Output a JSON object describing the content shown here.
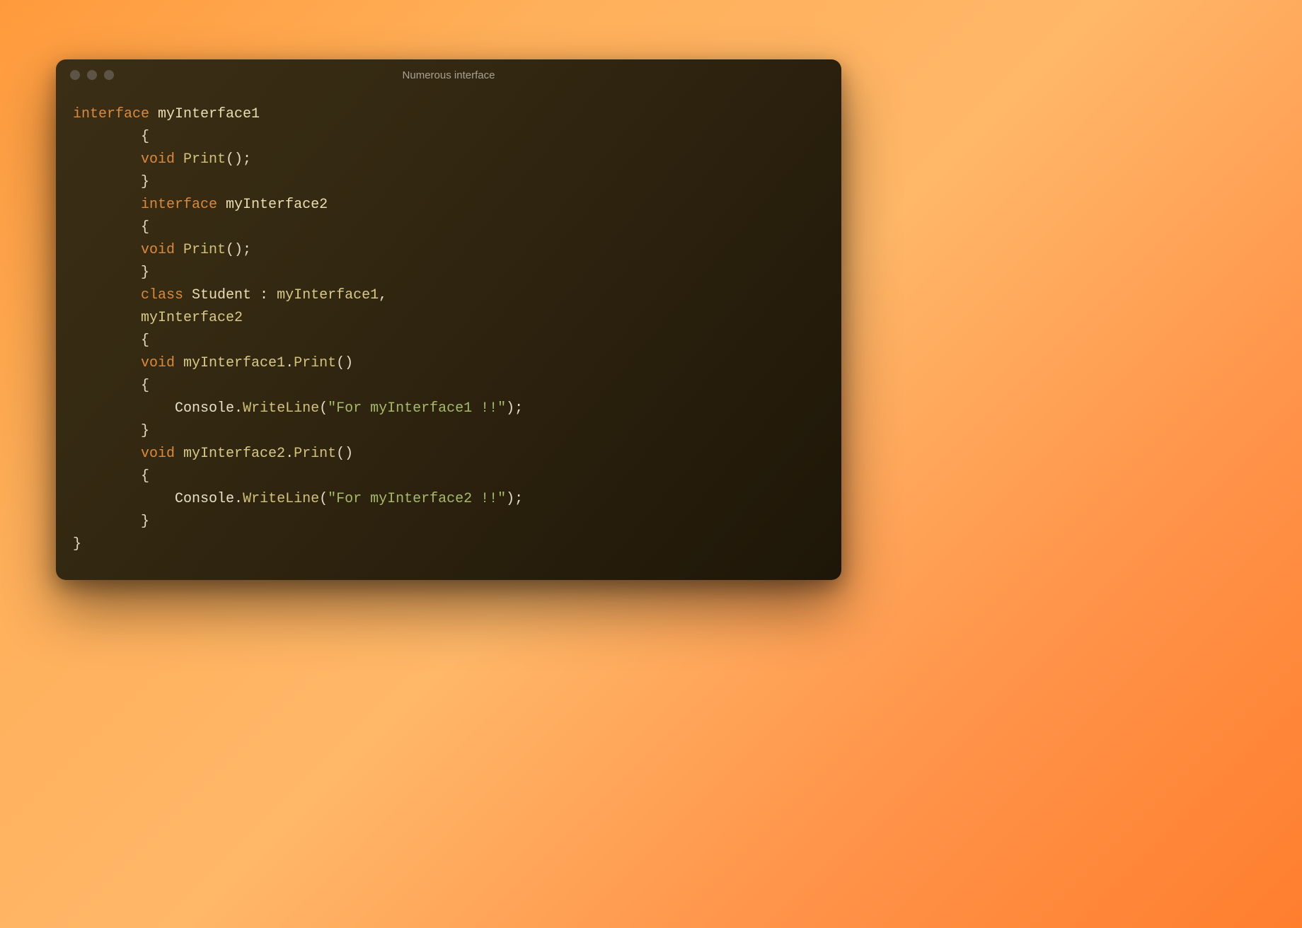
{
  "window": {
    "title": "Numerous interface"
  },
  "code": {
    "l1_kw": "interface ",
    "l1_name": "myInterface1",
    "l2_brace": "        {",
    "l3_kw": "        void ",
    "l3_fn": "Print",
    "l3_rest": "();",
    "l4_brace": "        }",
    "l5_kw": "        interface ",
    "l5_name": "myInterface2",
    "l6_brace": "        {",
    "l7_kw": "        void ",
    "l7_fn": "Print",
    "l7_rest": "();",
    "l8_brace": "        }",
    "l9_kw": "        class ",
    "l9_name": "Student",
    "l9_sep": " : ",
    "l9_i1": "myInterface1",
    "l9_comma": ",",
    "l10_i2": "        myInterface2",
    "l11_brace": "        {",
    "l12_kw": "        void ",
    "l12_scope": "myInterface1",
    "l12_dot": ".",
    "l12_fn": "Print",
    "l12_rest": "()",
    "l13_brace": "        {",
    "l14_indent": "            ",
    "l14_console": "Console",
    "l14_dot": ".",
    "l14_method": "WriteLine",
    "l14_open": "(",
    "l14_str": "\"For myInterface1 !!\"",
    "l14_close": ");",
    "l15_brace": "        }",
    "l16_kw": "        void ",
    "l16_scope": "myInterface2",
    "l16_dot": ".",
    "l16_fn": "Print",
    "l16_rest": "()",
    "l17_brace": "        {",
    "l18_indent": "            ",
    "l18_console": "Console",
    "l18_dot": ".",
    "l18_method": "WriteLine",
    "l18_open": "(",
    "l18_str": "\"For myInterface2 !!\"",
    "l18_close": ");",
    "l19_brace": "        }",
    "l20_brace": "}"
  }
}
